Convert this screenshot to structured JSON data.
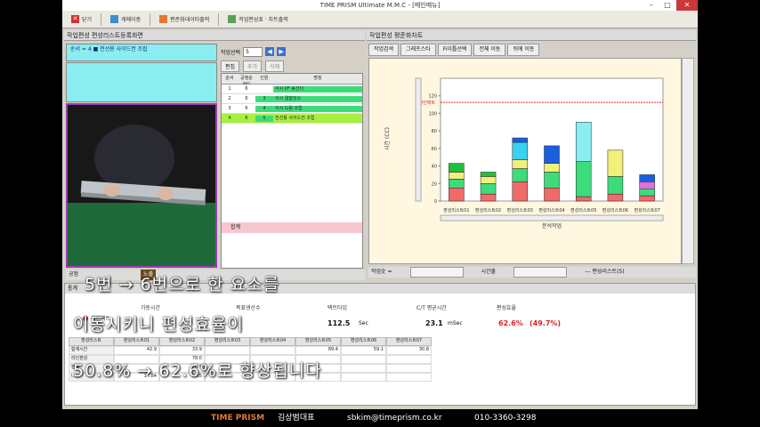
{
  "window": {
    "title": "TIME PRISM Ultimate M.M.C - [메인메뉴]"
  },
  "toolbar": {
    "close": "닫기",
    "camera": "캐메이종",
    "output": "편준화데이타출력",
    "chart": "작업편성표 · 차트출력"
  },
  "left_panel": {
    "title": "작업편성 편성리스트등록화면",
    "seq_label": "순서 = 4 ■ 전선용 사이드컨 조립",
    "op_select_label": "작업선택",
    "op_select_value": "5",
    "btn_edit": "편집",
    "btn_add": "추가",
    "btn_delete": "삭제",
    "table_headers": [
      "순서",
      "공정순NO",
      "인원",
      "명칭"
    ],
    "rows": [
      {
        "seq": "1",
        "no": "6",
        "n": "",
        "name": "사시 I/F 송선다"
      },
      {
        "seq": "2",
        "no": "6",
        "n": "3",
        "name": "사시 결합잇스"
      },
      {
        "seq": "3",
        "no": "6",
        "n": "4",
        "name": "사시 드럼 조립"
      },
      {
        "seq": "4",
        "no": "6",
        "n": "5",
        "name": "전선용 사이드컨 조립"
      }
    ],
    "total_label": "합계",
    "bottom_label": "공정",
    "record_label": "노출"
  },
  "right_panel": {
    "title": "작업편성 평준화차트",
    "tabs": [
      "작업검색",
      "그래프스타",
      "Fi이틀선택",
      "전체 이동",
      "뒤에 이동"
    ],
    "status_left": "작업숫 =",
    "status_mid": "시간출",
    "status_right": "--- 편성리스트(5)"
  },
  "chart_data": {
    "type": "bar",
    "ylabel": "시간 (CC)",
    "xlabel": "분석작업",
    "ylim": [
      0,
      140
    ],
    "yticks": [
      0,
      20,
      40,
      60,
      80,
      100,
      120
    ],
    "reference_line": {
      "label": "라인택트",
      "value": 112.5
    },
    "categories": [
      "편성리스트01",
      "편성리스트02",
      "편성리스트03",
      "편성리스트04",
      "편성리스트05",
      "편성리스트06",
      "편성리스트07"
    ],
    "stacks": [
      [
        {
          "v": 15,
          "c": "#f06a6a"
        },
        {
          "v": 10,
          "c": "#3ddc7a"
        },
        {
          "v": 8,
          "c": "#f0f07a"
        },
        {
          "v": 10,
          "c": "#1fbf3a"
        }
      ],
      [
        {
          "v": 8,
          "c": "#f06a6a"
        },
        {
          "v": 12,
          "c": "#3ddc7a"
        },
        {
          "v": 8,
          "c": "#f0f07a"
        },
        {
          "v": 5,
          "c": "#1fbf3a"
        }
      ],
      [
        {
          "v": 22,
          "c": "#f06a6a"
        },
        {
          "v": 15,
          "c": "#3ddc7a"
        },
        {
          "v": 10,
          "c": "#f0f07a"
        },
        {
          "v": 20,
          "c": "#3ad0f0"
        },
        {
          "v": 5,
          "c": "#1a5fe0"
        }
      ],
      [
        {
          "v": 15,
          "c": "#f06a6a"
        },
        {
          "v": 18,
          "c": "#3ddc7a"
        },
        {
          "v": 10,
          "c": "#f0f07a"
        },
        {
          "v": 20,
          "c": "#1a5fe0"
        }
      ],
      [
        {
          "v": 5,
          "c": "#f06a6a"
        },
        {
          "v": 40,
          "c": "#3ddc7a"
        },
        {
          "v": 45,
          "c": "#8aeef0"
        }
      ],
      [
        {
          "v": 8,
          "c": "#f06a6a"
        },
        {
          "v": 20,
          "c": "#3ddc7a"
        },
        {
          "v": 30,
          "c": "#f0f07a"
        }
      ],
      [
        {
          "v": 6,
          "c": "#f06a6a"
        },
        {
          "v": 8,
          "c": "#3ddc7a"
        },
        {
          "v": 8,
          "c": "#e070e0"
        },
        {
          "v": 8,
          "c": "#1a5fe0"
        }
      ]
    ]
  },
  "stats": {
    "title": "통계",
    "line_label": "라인택트",
    "hdr_work_time": "가동시간",
    "hdr_persons": "목표생산수",
    "hdr_tact": "택트타임",
    "hdr_cd": "C/T 평균시간",
    "hdr_eff": "편성효율",
    "tact_value": "112.5",
    "tact_unit": "Sec",
    "cd_value": "23.1",
    "cd_unit": "mSec",
    "eff_value": "62.6%",
    "eff_prev": "(49.7%)",
    "grid_headers": [
      "편성리스트",
      "편성리스트01",
      "편성리스트02",
      "편성리스트03",
      "편성리스트04",
      "편성리스트05",
      "편성리스트06",
      "편성리스트07"
    ],
    "grid_rows": [
      [
        "합계시간",
        "42.9",
        "33.9",
        "",
        "",
        "89.4",
        "59.1",
        "30.8"
      ],
      [
        "라인편성",
        "",
        "78.0",
        "",
        "",
        "",
        "",
        ""
      ],
      [
        "편성",
        "",
        "0.5",
        "",
        "",
        "",
        "",
        ""
      ],
      [
        "나발",
        "17.84",
        "8.65",
        "",
        "",
        "",
        "",
        ""
      ]
    ]
  },
  "overlay": {
    "line1": "5번 → 6번으로 한 요소를",
    "line2": "이동시키니 편성효율이",
    "line3": "50.8% → 62.6%로 향상됩니다"
  },
  "footer": {
    "brand": "TIME PRISM",
    "person": "김상범대표",
    "email": "sbkim@timeprism.co.kr",
    "phone": "010-3360-3298"
  },
  "colors": {
    "accent_cyan": "#8aeef0",
    "chart_bg": "#fff7e0",
    "highlight_green": "#a8f040"
  }
}
